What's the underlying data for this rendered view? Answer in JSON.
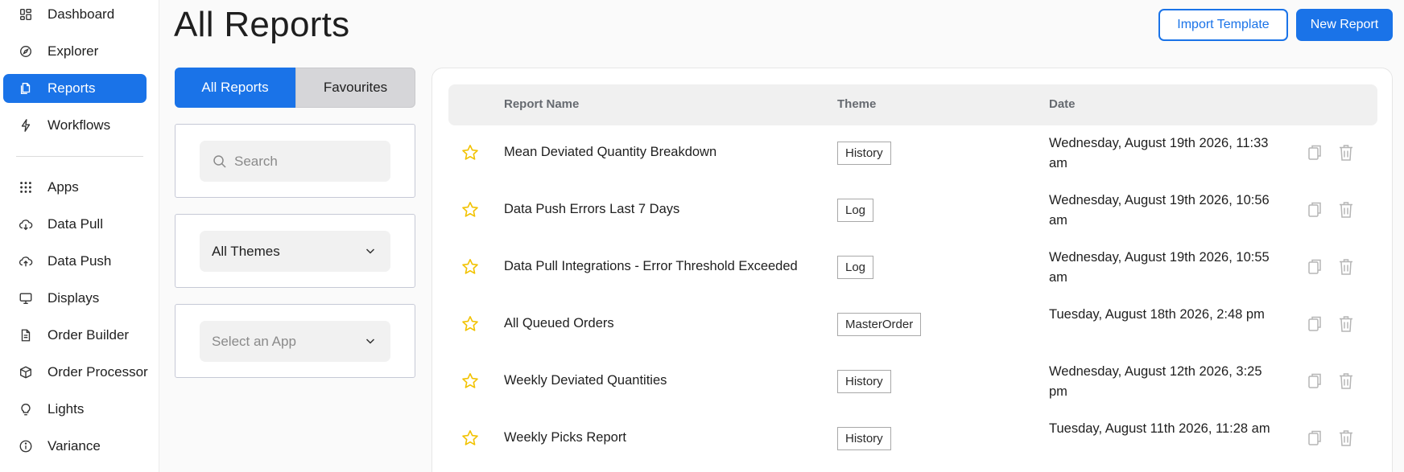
{
  "sidebar": {
    "items": [
      {
        "label": "Dashboard",
        "icon": "dashboard-icon",
        "active": false
      },
      {
        "label": "Explorer",
        "icon": "compass-icon",
        "active": false
      },
      {
        "label": "Reports",
        "icon": "reports-icon",
        "active": true
      },
      {
        "label": "Workflows",
        "icon": "lightning-icon",
        "active": false
      },
      {
        "label": "Apps",
        "icon": "apps-grid-icon",
        "active": false
      },
      {
        "label": "Data Pull",
        "icon": "cloud-download-icon",
        "active": false
      },
      {
        "label": "Data Push",
        "icon": "cloud-upload-icon",
        "active": false
      },
      {
        "label": "Displays",
        "icon": "monitor-icon",
        "active": false
      },
      {
        "label": "Order Builder",
        "icon": "document-icon",
        "active": false
      },
      {
        "label": "Order Processor",
        "icon": "box-icon",
        "active": false
      },
      {
        "label": "Lights",
        "icon": "lightbulb-icon",
        "active": false
      },
      {
        "label": "Variance",
        "icon": "info-icon",
        "active": false
      }
    ]
  },
  "header": {
    "title": "All Reports",
    "import_label": "Import Template",
    "new_label": "New Report"
  },
  "tabs": {
    "all_label": "All Reports",
    "favourites_label": "Favourites"
  },
  "filters": {
    "search_placeholder": "Search",
    "theme_value": "All Themes",
    "app_placeholder": "Select an App"
  },
  "table": {
    "columns": [
      "Report Name",
      "Theme",
      "Date"
    ],
    "rows": [
      {
        "name": "Mean Deviated Quantity Breakdown",
        "theme": "History",
        "date": "Wednesday, August 19th 2026, 11:33 am"
      },
      {
        "name": "Data Push Errors Last 7 Days",
        "theme": "Log",
        "date": "Wednesday, August 19th 2026, 10:56 am"
      },
      {
        "name": "Data Pull Integrations - Error Threshold Exceeded",
        "theme": "Log",
        "date": "Wednesday, August 19th 2026, 10:55 am"
      },
      {
        "name": "All Queued Orders",
        "theme": "MasterOrder",
        "date": "Tuesday, August 18th 2026, 2:48 pm"
      },
      {
        "name": "Weekly Deviated Quantities",
        "theme": "History",
        "date": "Wednesday, August 12th 2026, 3:25 pm"
      },
      {
        "name": "Weekly Picks Report",
        "theme": "History",
        "date": "Tuesday, August 11th 2026, 11:28 am"
      }
    ]
  },
  "colors": {
    "accent": "#1a73e8",
    "star": "#f2c200",
    "action_icon": "#b5b5b5"
  }
}
